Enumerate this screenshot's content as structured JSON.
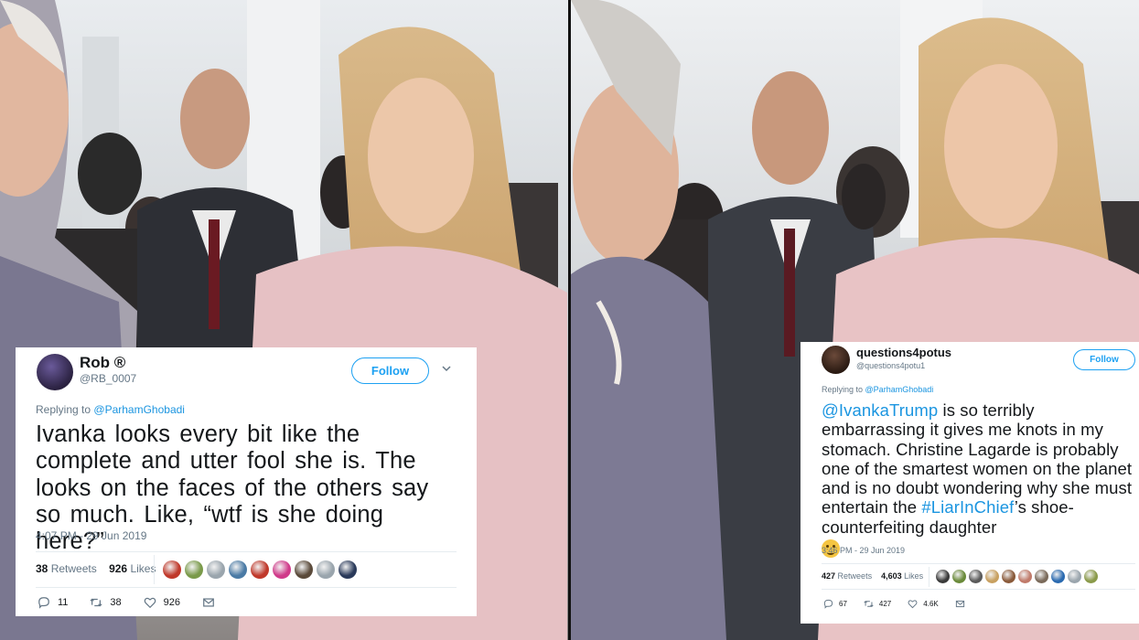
{
  "tweet_left": {
    "name": "Rob ®",
    "handle": "@RB_0007",
    "follow_label": "Follow",
    "reply_prefix": "Replying to",
    "reply_to": "@ParhamGhobadi",
    "text": "Ivanka looks every bit like the complete and utter fool she is. The looks on the faces of the others say so much. Like, “wtf is she doing here?”",
    "timestamp": "4:07 PM - 29 Jun 2019",
    "retweets_count": "38",
    "retweets_label": "Retweets",
    "likes_count": "926",
    "likes_label": "Likes",
    "reply_count": "11",
    "retweet_count_action": "38",
    "like_count_action": "926",
    "liker_colors": [
      "#c0392b",
      "#7a9a4a",
      "#9aa5ad",
      "#4a7aa5",
      "#c0392b",
      "#d03a8a",
      "#5a4a3a",
      "#9aa5ad",
      "#2a3a5a"
    ]
  },
  "tweet_right": {
    "name": "questions4potus",
    "handle": "@questions4potu1",
    "follow_label": "Follow",
    "reply_prefix": "Replying to",
    "reply_to": "@ParhamGhobadi",
    "mention": "@IvankaTrump",
    "text_part1": " is so terribly embarrassing it gives me knots in my stomach. Christine Lagarde is probably one of the smartest women on the planet and is no doubt wondering why she must entertain the ",
    "hashtag": "#LiarInChief",
    "text_part2": "’s shoe-counterfeiting daughter",
    "emoji_name": "confused-face-emoji",
    "timestamp": "3:46 PM - 29 Jun 2019",
    "retweets_count": "427",
    "retweets_label": "Retweets",
    "likes_count": "4,603",
    "likes_label": "Likes",
    "reply_count": "67",
    "retweet_count_action": "427",
    "like_count_action": "4.6K",
    "liker_colors": [
      "#3a3a3a",
      "#6a8a3a",
      "#5a5a5a",
      "#c8a060",
      "#8a5a3a",
      "#c07a6a",
      "#7a6a5a",
      "#2a6ab0",
      "#9aa5ad",
      "#8a9a4a"
    ]
  },
  "colors": {
    "link": "#1b95e0",
    "follow": "#1da1f2",
    "muted": "#657786"
  }
}
